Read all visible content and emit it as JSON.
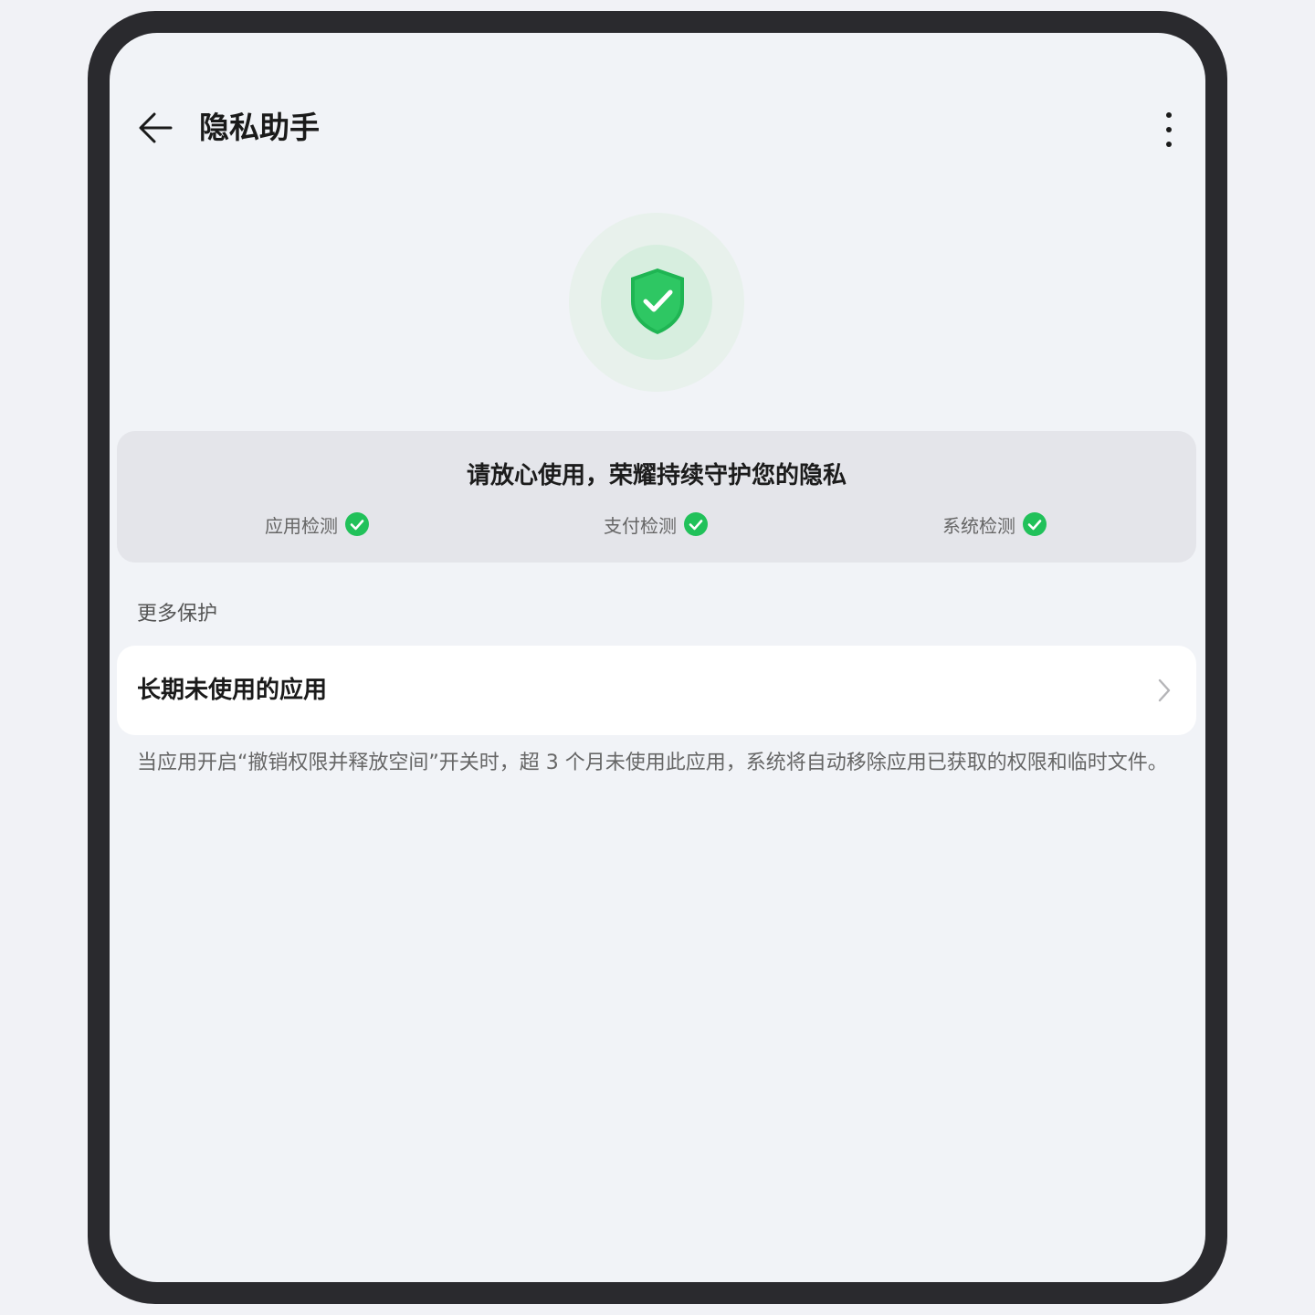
{
  "header": {
    "title": "隐私助手",
    "back_icon": "arrow-left-icon",
    "more_icon": "more-vertical-icon"
  },
  "status": {
    "icon": "shield-check-icon",
    "message": "请放心使用，荣耀持续守护您的隐私",
    "checks": [
      {
        "label": "应用检测",
        "icon": "check-circle-icon"
      },
      {
        "label": "支付检测",
        "icon": "check-circle-icon"
      },
      {
        "label": "系统检测",
        "icon": "check-circle-icon"
      }
    ]
  },
  "more_protection": {
    "section_title": "更多保护",
    "items": [
      {
        "label": "长期未使用的应用",
        "icon": "chevron-right-icon"
      }
    ],
    "description": "当应用开启“撤销权限并释放空间”开关时，超 3 个月未使用此应用，系统将自动移除应用已获取的权限和临时文件。"
  },
  "colors": {
    "accent_green": "#21c15a",
    "background": "#f1f3f7",
    "card_grey": "#e4e5ea"
  }
}
